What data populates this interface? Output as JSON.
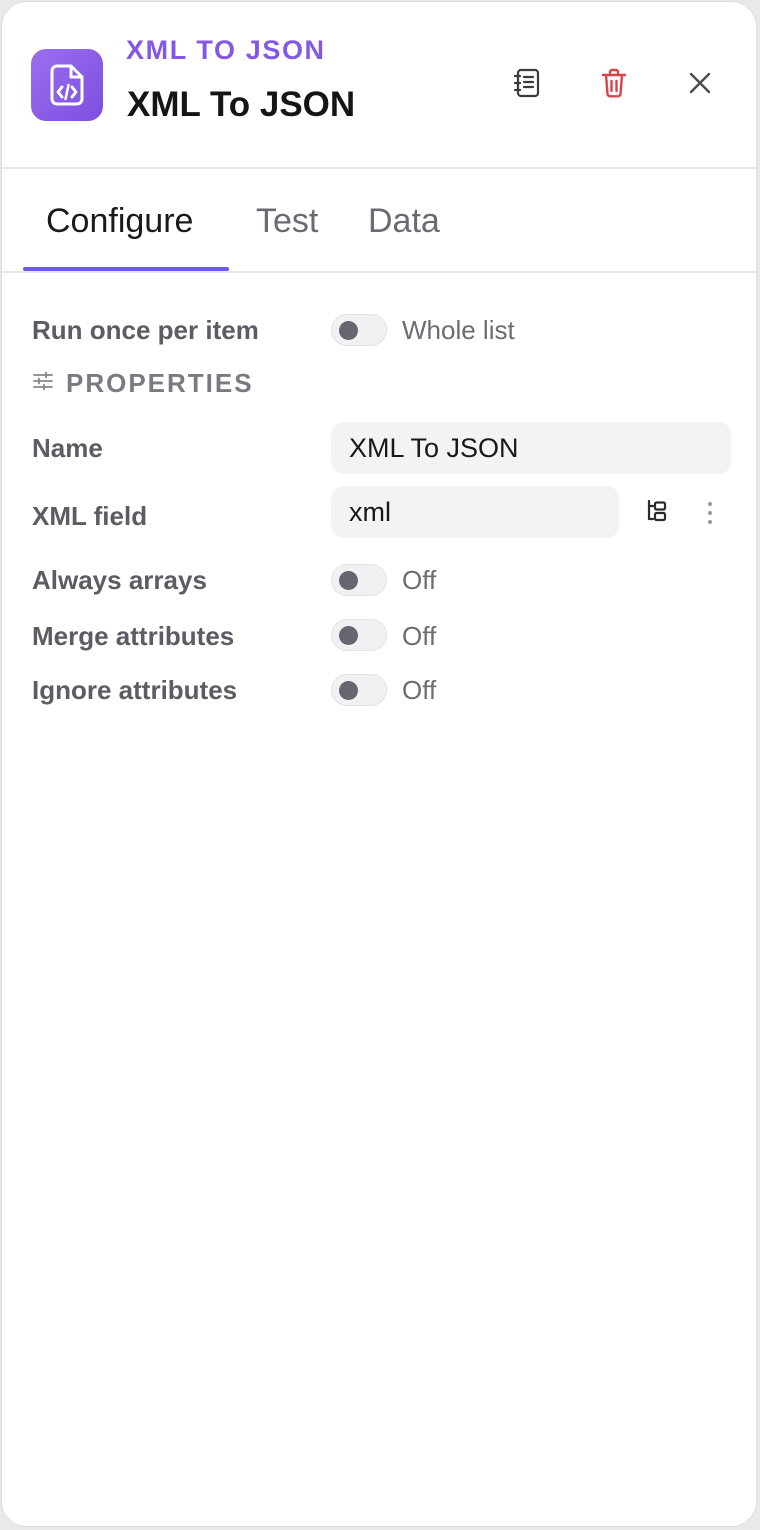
{
  "header": {
    "node_type": "XML TO JSON",
    "node_title": "XML To JSON",
    "icons": {
      "node": "file-code-icon",
      "notes": "notebook-icon",
      "delete": "trash-icon",
      "close": "close-icon"
    },
    "colors": {
      "accent": "#8458e6",
      "delete": "#d9434a"
    }
  },
  "tabs": [
    {
      "label": "Configure",
      "active": true
    },
    {
      "label": "Test",
      "active": false
    },
    {
      "label": "Data",
      "active": false
    }
  ],
  "run_mode": {
    "label": "Run once per item",
    "state": "Whole list",
    "on": false
  },
  "properties": {
    "section_label": "PROPERTIES",
    "section_icon": "sliders-icon",
    "name": {
      "label": "Name",
      "value": "XML To JSON"
    },
    "xml_field": {
      "label": "XML field",
      "value": "xml",
      "picker_icon": "data-tree-icon",
      "menu_icon": "more-vertical-icon"
    },
    "always_arrays": {
      "label": "Always arrays",
      "state": "Off",
      "on": false
    },
    "merge_attributes": {
      "label": "Merge attributes",
      "state": "Off",
      "on": false
    },
    "ignore_attributes": {
      "label": "Ignore attributes",
      "state": "Off",
      "on": false
    }
  }
}
